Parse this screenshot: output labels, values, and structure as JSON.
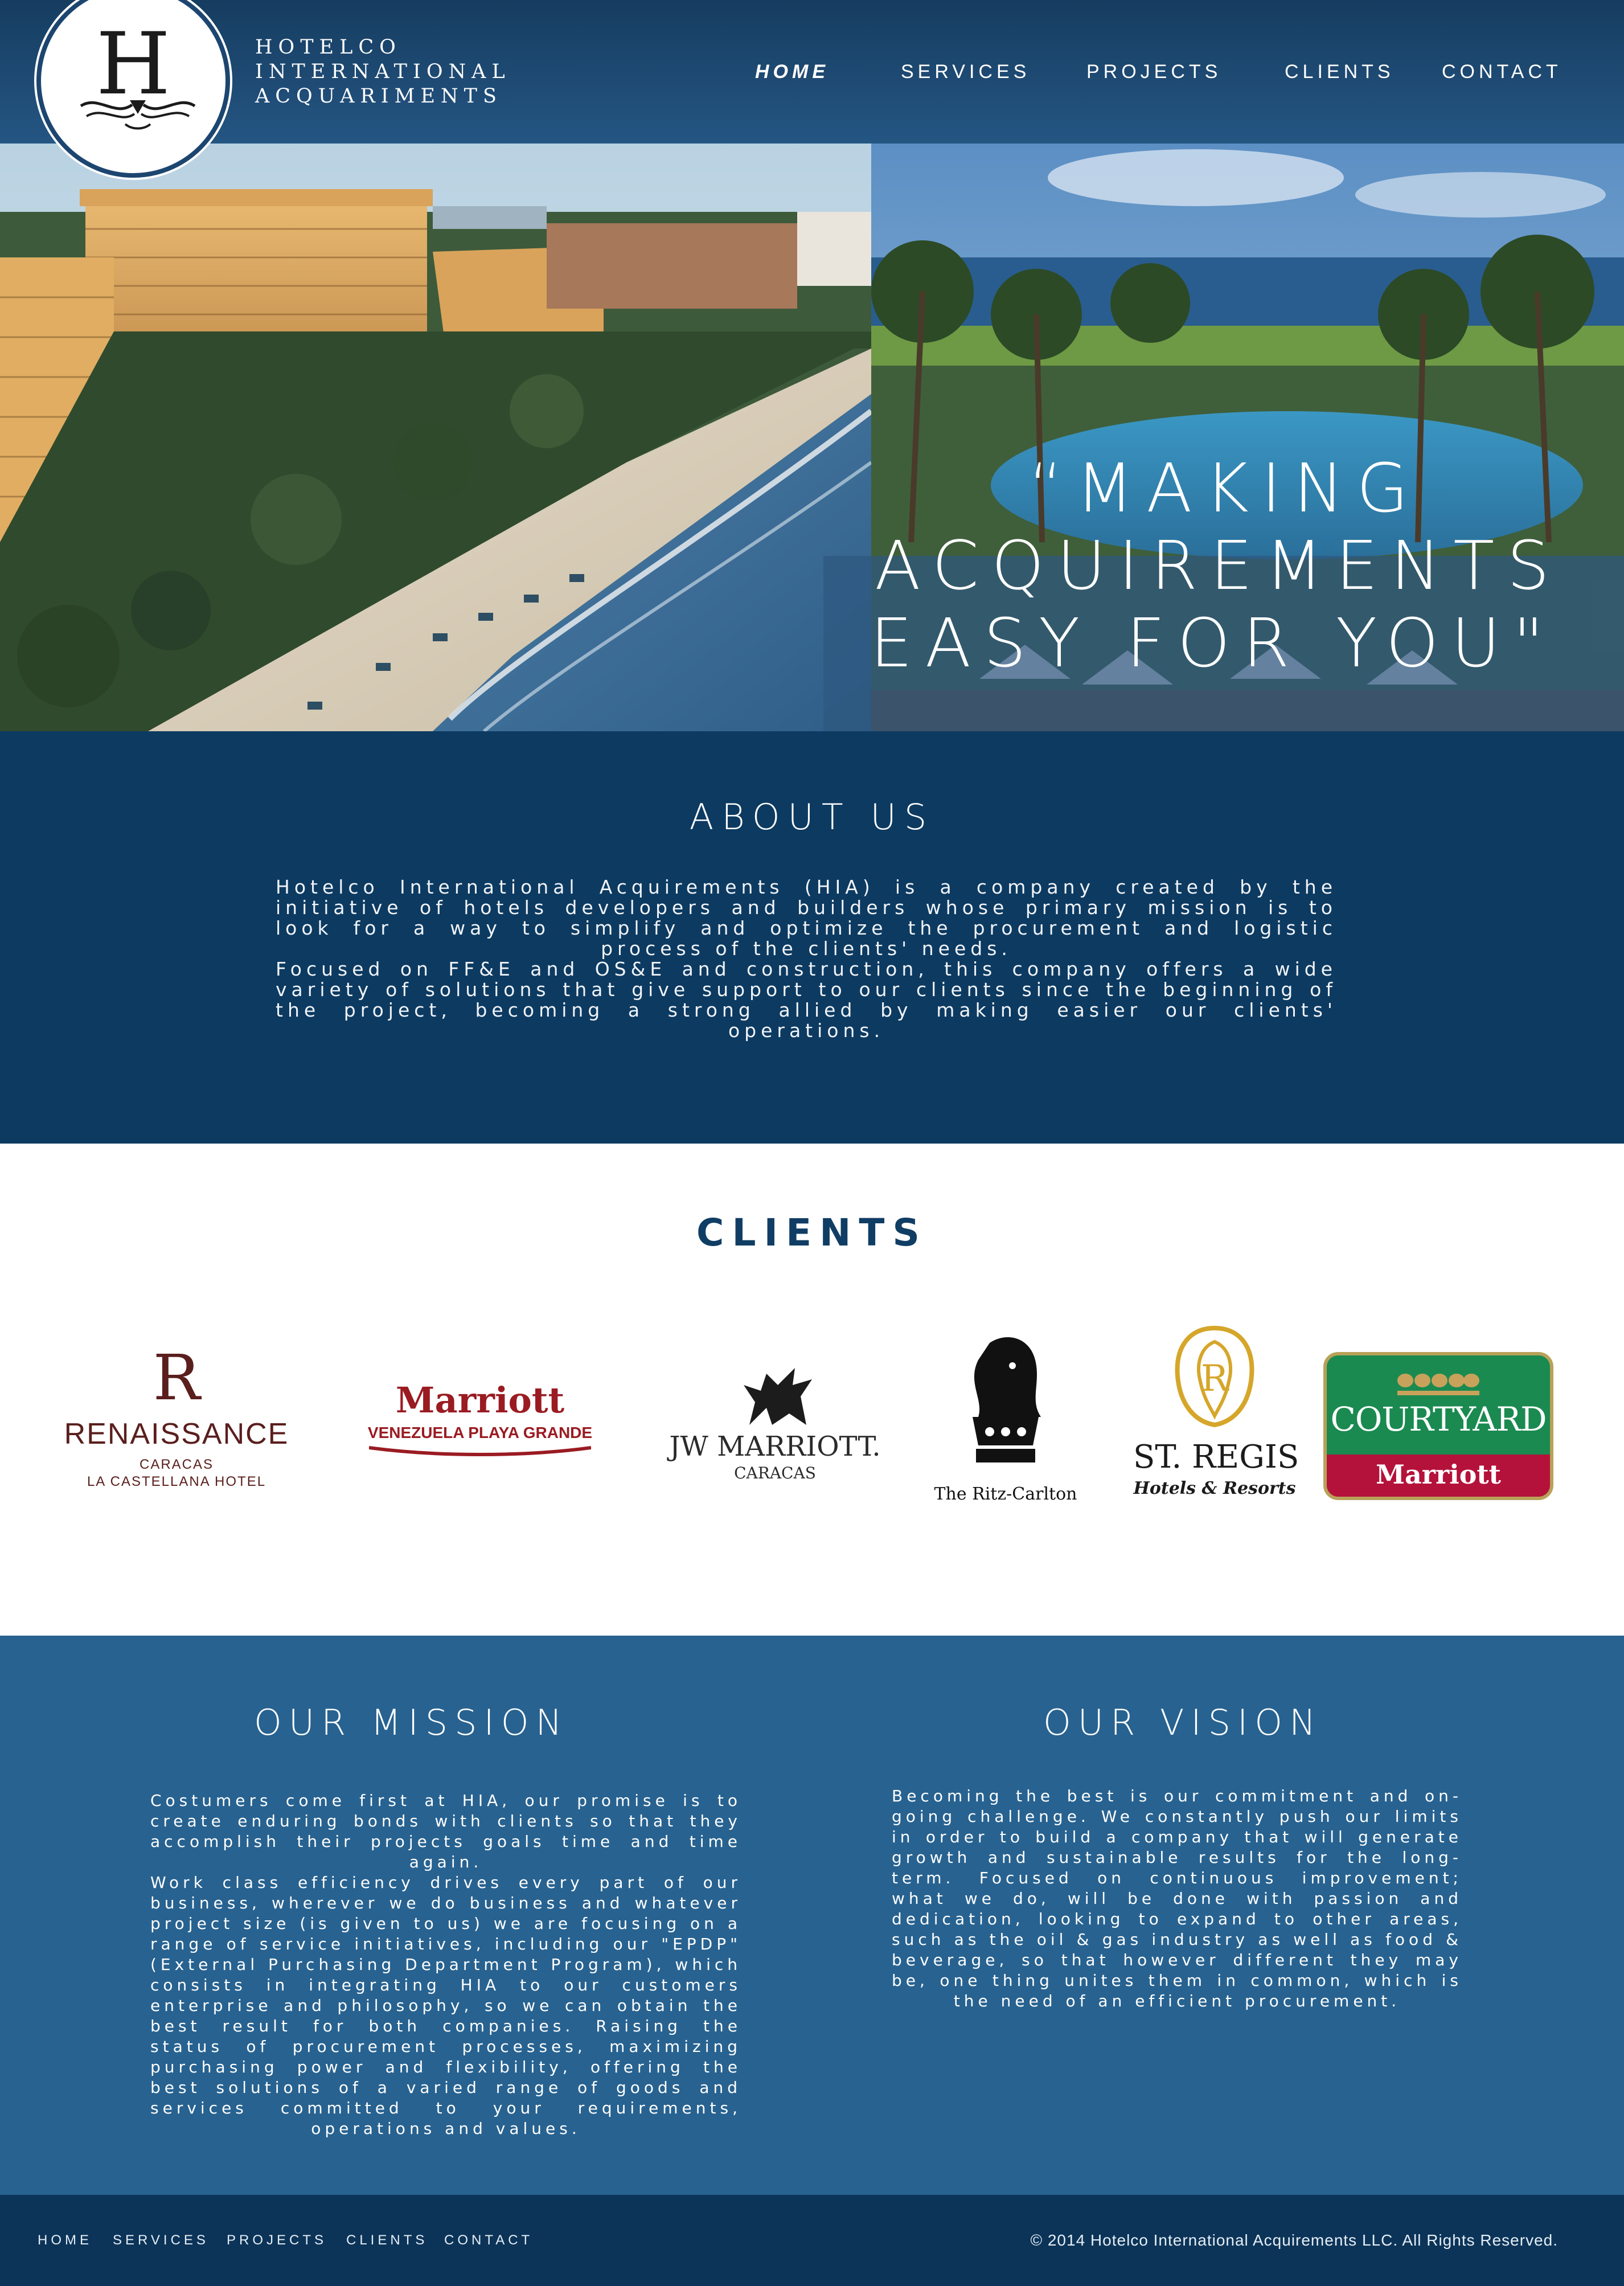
{
  "header": {
    "brand_line1": "HOTELCO",
    "brand_line2": "INTERNATIONAL",
    "brand_line3": "ACQUARIMENTS",
    "logo_letter": "H",
    "nav": {
      "home": "HOME",
      "services": "SERVICES",
      "projects": "PROJECTS",
      "clients": "CLIENTS",
      "contact": "CONTACT"
    }
  },
  "hero": {
    "quote_line1": "“MAKING",
    "quote_line2": "ACQUIREMENTS",
    "quote_line3": "EASY FOR YOU\""
  },
  "about": {
    "title": "ABOUT US",
    "paragraph1": "Hotelco International Acquirements (HIA) is a company created by the initiative of hotels developers and builders whose primary mission is to look for a way to simplify and optimize the procurement and logistic process of the clients' needs.",
    "paragraph2": "Focused on FF&E and OS&E and construction, this company offers a wide variety of solutions that give support to our clients since the beginning of the project, becoming a strong allied by making easier our clients' operations."
  },
  "clients": {
    "title": "CLIENTS",
    "renaissance": {
      "mark": "R",
      "name": "RENAISSANCE",
      "line1": "CARACAS",
      "line2": "LA CASTELLANA HOTEL"
    },
    "marriott_venezuela": {
      "name": "Marriott",
      "line1": "VENEZUELA PLAYA GRANDE"
    },
    "jw_marriott": {
      "name": "JW MARRIOTT.",
      "line1": "CARACAS"
    },
    "ritz_carlton": {
      "name": "The Ritz-Carlton"
    },
    "st_regis": {
      "name": "ST. REGIS",
      "line1": "Hotels & Resorts"
    },
    "courtyard": {
      "name": "COURTYARD",
      "line1": "Marriott"
    }
  },
  "mission": {
    "title": "OUR MISSION",
    "paragraph1": "Costumers come first at HIA, our promise is to create enduring bonds with clients so that they accomplish their projects goals time and time again.",
    "paragraph2": "Work class efficiency drives every part of our business, wherever we do business and whatever project size (is given to us) we are focusing on a range of service initiatives, including our \"EPDP\" (External Purchasing Department Program), which consists in integrating HIA to our customers enterprise and philosophy, so we can obtain the best result for both companies. Raising the status of procurement processes, maximizing purchasing power and flexibility, offering the best solutions of a varied range of goods and services committed to your requirements, operations and values."
  },
  "vision": {
    "title": "OUR VISION",
    "paragraph1": "Becoming the best is our commitment and on-going challenge. We constantly push our limits in order to build a company that will generate growth and sustainable results for the long-term. Focused on continuous improvement; what we do, will be done with passion and dedication, looking to expand to other areas, such as the oil & gas industry as well as food & beverage, so that however different they may be, one thing unites them in common, which is the need of an efficient procurement."
  },
  "footer": {
    "home": "HOME",
    "services": "SERVICES",
    "projects": "PROJECTS",
    "clients": "CLIENTS",
    "contact": "CONTACT",
    "copyright": "© 2014 Hotelco International Acquirements LLC. All Rights Reserved."
  },
  "colors": {
    "header": "#1e4a73",
    "about_bg": "#0d3a60",
    "mission_bg": "#276290",
    "footer_bg": "#0c3458",
    "clients_title": "#0f3d64"
  }
}
